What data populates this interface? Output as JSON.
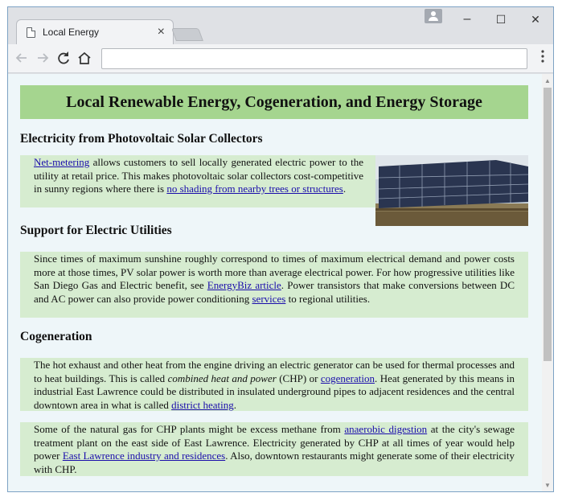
{
  "browser": {
    "tab_title": "Local Energy",
    "tab_close": "×",
    "address_value": "",
    "icons": {
      "back": "back-arrow-icon",
      "forward": "forward-arrow-icon",
      "reload": "reload-icon",
      "home": "home-icon",
      "menu": "kebab-menu-icon"
    },
    "window_controls": {
      "minimize": "–",
      "maximize": "☐",
      "close": "✕"
    }
  },
  "page": {
    "banner_title": "Local Renewable Energy, Cogeneration, and Energy Storage",
    "sections": [
      {
        "heading": "Electricity from Photovoltaic Solar Collectors",
        "link_netmetering": "Net-metering",
        "text_1": " allows customers to sell locally generated electric power to the utility at retail price. This makes photovoltaic solar collectors cost-competitive in sunny regions where there is ",
        "link_shading": "no shading from nearby trees or structures",
        "text_2": "."
      },
      {
        "heading": "Support for Electric Utilities",
        "text_1": "Since times of maximum sunshine roughly correspond to times of maximum electrical demand and power costs more at those times, PV solar power is worth more than average electrical power. For how progressive utilities like San Diego Gas and Electric benefit, see ",
        "link_energybiz": "EnergyBiz article",
        "text_2": ". Power transistors that make conversions between DC and AC power can also provide power conditioning ",
        "link_services": "services",
        "text_3": " to regional utilities."
      },
      {
        "heading": "Cogeneration",
        "p1_text_1": "The hot exhaust and other heat from the engine driving an electric generator can be used for thermal processes and to heat buildings. This is called ",
        "p1_em": "combined heat and power",
        "p1_text_2": " (CHP) or ",
        "p1_link_cogeneration": "cogeneration",
        "p1_text_3": ". Heat generated by this means in industrial East Lawrence could be distributed in insulated underground pipes to adjacent residences and the central downtown area in what is called ",
        "p1_link_district": "district heating",
        "p1_text_4": ".",
        "p2_text_1": "Some of the natural gas for CHP plants might be excess methane from ",
        "p2_link_anaerobic": "anaerobic digestion",
        "p2_text_2": " at the city's sewage treatment plant on the east side of East Lawrence. Electricity generated by CHP at all times of year would help power ",
        "p2_link_eastlawrence": "East Lawrence industry and residences",
        "p2_text_3": ". Also, downtown restaurants might generate some of their electricity with CHP."
      }
    ]
  },
  "colors": {
    "banner": "#a5d58f",
    "paragraph_bg": "#d6ecd0",
    "page_bg": "#eef6f9",
    "link": "#1a0dab"
  }
}
